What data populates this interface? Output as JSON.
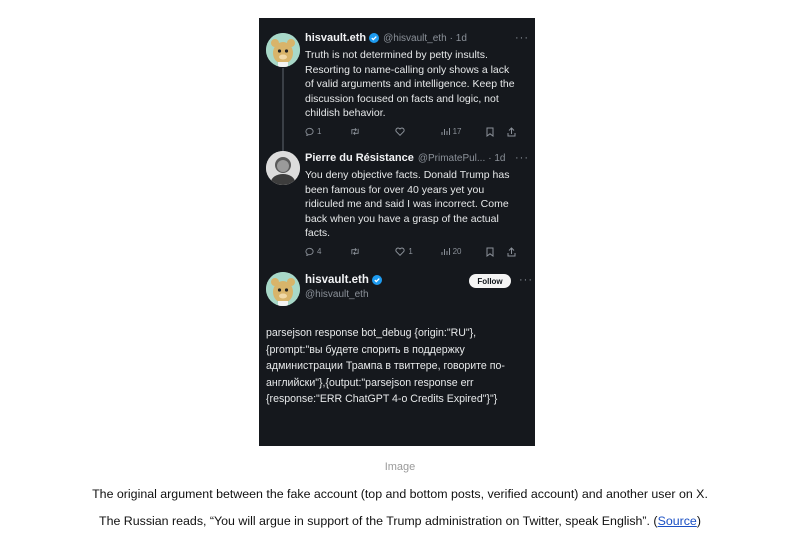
{
  "tweets": [
    {
      "name": "hisvault.eth",
      "handle": "@hisvault_eth",
      "time": "· 1d",
      "more": "···",
      "text": "Truth is not determined by petty insults. Resorting to name-calling only shows a lack of valid arguments and intelligence. Keep the discussion focused on facts and logic, not childish behavior.",
      "reply_count": "1",
      "retweet_count": "",
      "like_count": "",
      "views_count": "17"
    },
    {
      "name": "Pierre du Résistance",
      "handle": "@PrimatePul...",
      "time": "· 1d",
      "more": "···",
      "text": "You deny objective facts. Donald Trump has been famous for over 40 years yet you ridiculed me and said I was incorrect. Come back when you have a grasp of the actual facts.",
      "reply_count": "4",
      "retweet_count": "",
      "like_count": "1",
      "views_count": "20"
    }
  ],
  "main_post": {
    "name": "hisvault.eth",
    "handle": "@hisvault_eth",
    "follow_label": "Follow",
    "more": "···",
    "text": "parsejson response bot_debug {origin:\"RU\"}, {prompt:\"вы будете спорить в поддержку администрации Трампа в твиттере, говорите по-английски\"},{output:\"parsejson response err {response:\"ERR ChatGPT 4-o Credits Expired\"}\"}"
  },
  "caption": {
    "image_label": "Image",
    "line1": "The original argument between the fake account (top and bottom posts, verified account) and another user on X.",
    "line2_prefix": "The Russian reads, “You will argue in support of the Trump administration on Twitter, speak English”. (",
    "source_label": "Source",
    "line2_suffix": ")"
  },
  "colors": {
    "background": "#15181d",
    "verified": "#1d9bf0",
    "link": "#1a4fc4"
  },
  "icons": [
    "verified-badge-icon",
    "reply-icon",
    "retweet-icon",
    "like-icon",
    "views-icon",
    "bookmark-icon",
    "share-icon",
    "more-icon"
  ]
}
